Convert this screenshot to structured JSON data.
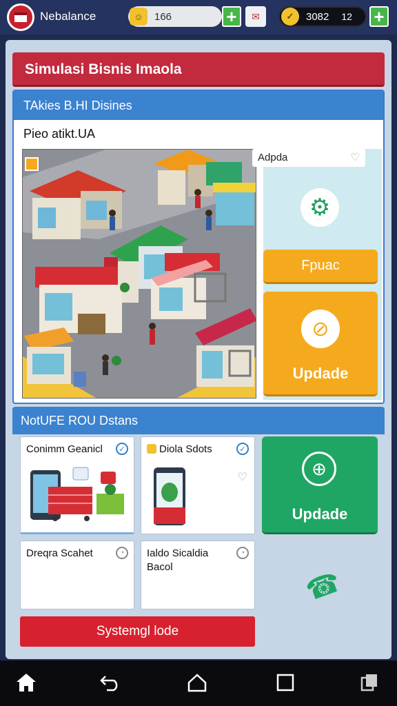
{
  "header": {
    "app_name": "Nebalance",
    "energy_value": "166",
    "coins_value": "3082",
    "coins_secondary": "12"
  },
  "title": "Simulasi Bisnis Imaola",
  "panel": {
    "heading": "TAkies B.HI Disines",
    "subheading": "Pieo atikt.UA",
    "side_card": "Adpda",
    "orange_button": "Fpuac",
    "orange_big_button": "Updade"
  },
  "section2": {
    "heading": "NotUFE ROU Dstans",
    "cards": [
      {
        "title": "Conimm Geanicl"
      },
      {
        "title": "Diola Sdots"
      },
      {
        "title": "Dreqra Scahet"
      },
      {
        "title": "Ialdo Sicaldia Bacol"
      }
    ],
    "green_button": "Updade",
    "red_button": "Systemgl lode"
  },
  "colors": {
    "title_red": "#c22a3e",
    "panel_blue": "#3b82cf",
    "orange": "#f5aa1d",
    "green": "#1fa664",
    "red_button": "#d8212f"
  },
  "icons": [
    "logo-icon",
    "energy-icon",
    "coin-icon",
    "mail-icon",
    "plus-icon",
    "gear-icon",
    "no-phone-icon",
    "globe-icon",
    "phone-icon",
    "home-icon",
    "back-icon",
    "recents-icon",
    "screenshot-icon"
  ]
}
